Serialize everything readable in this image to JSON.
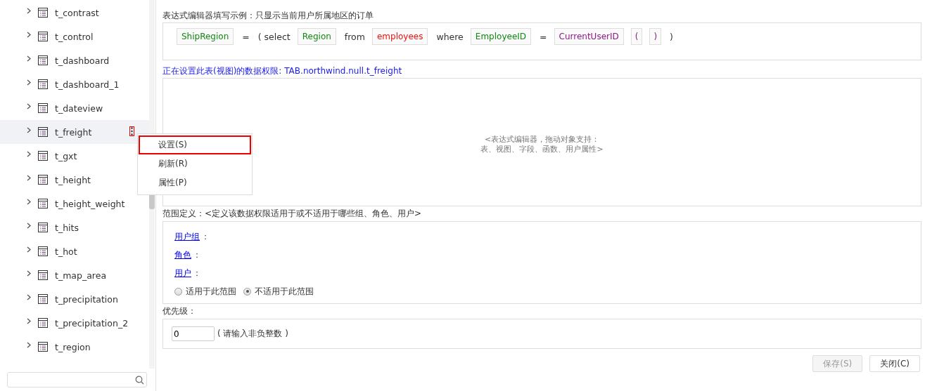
{
  "sidebar": {
    "items": [
      {
        "label": "t_contrast",
        "selected": false
      },
      {
        "label": "t_control",
        "selected": false
      },
      {
        "label": "t_dashboard",
        "selected": false
      },
      {
        "label": "t_dashboard_1",
        "selected": false
      },
      {
        "label": "t_dateview",
        "selected": false
      },
      {
        "label": "t_freight",
        "selected": true
      },
      {
        "label": "t_gxt",
        "selected": false
      },
      {
        "label": "t_height",
        "selected": false
      },
      {
        "label": "t_height_weight",
        "selected": false
      },
      {
        "label": "t_hits",
        "selected": false
      },
      {
        "label": "t_hot",
        "selected": false
      },
      {
        "label": "t_map_area",
        "selected": false
      },
      {
        "label": "t_precipitation",
        "selected": false
      },
      {
        "label": "t_precipitation_2",
        "selected": false
      },
      {
        "label": "t_region",
        "selected": false
      }
    ],
    "context_menu": [
      {
        "label": "设置(S)",
        "selected": true
      },
      {
        "label": "刷新(R)",
        "selected": false
      },
      {
        "label": "属性(P)",
        "selected": false
      }
    ]
  },
  "example": {
    "title": "表达式编辑器填写示例：只显示当前用户所属地区的订单",
    "tokens": [
      {
        "kind": "field",
        "text": "ShipRegion"
      },
      {
        "kind": "text",
        "text": "="
      },
      {
        "kind": "text",
        "text": "( select"
      },
      {
        "kind": "field",
        "text": "Region"
      },
      {
        "kind": "text",
        "text": "from"
      },
      {
        "kind": "table",
        "text": "employees"
      },
      {
        "kind": "text",
        "text": "where"
      },
      {
        "kind": "field",
        "text": "EmployeeID"
      },
      {
        "kind": "text",
        "text": "="
      },
      {
        "kind": "variable",
        "text": "CurrentUserID"
      },
      {
        "kind": "paren",
        "text": "("
      },
      {
        "kind": "paren",
        "text": ")"
      },
      {
        "kind": "text",
        "text": ")"
      }
    ]
  },
  "editor": {
    "title": "正在设置此表(视图)的数据权限: TAB.northwind.null.t_freight",
    "placeholder_lines": [
      "<表达式编辑器，拖动对象支持：",
      "表、视图、字段、函数、用户属性>"
    ]
  },
  "scope": {
    "title": "范围定义：<定义该数据权限适用于或不适用于哪些组、角色、用户>",
    "links": [
      {
        "label": "用户组",
        "suffix": "："
      },
      {
        "label": "角色",
        "suffix": "："
      },
      {
        "label": "用户",
        "suffix": "："
      }
    ],
    "radios": [
      {
        "label": "适用于此范围",
        "selected": false
      },
      {
        "label": "不适用于此范围",
        "selected": true
      }
    ]
  },
  "priority": {
    "title": "优先级：",
    "value": "0",
    "hint": "( 请输入非负整数 )"
  },
  "buttons": [
    {
      "label": "保存(S)",
      "disabled": true
    },
    {
      "label": "关闭(C)",
      "disabled": false
    }
  ]
}
